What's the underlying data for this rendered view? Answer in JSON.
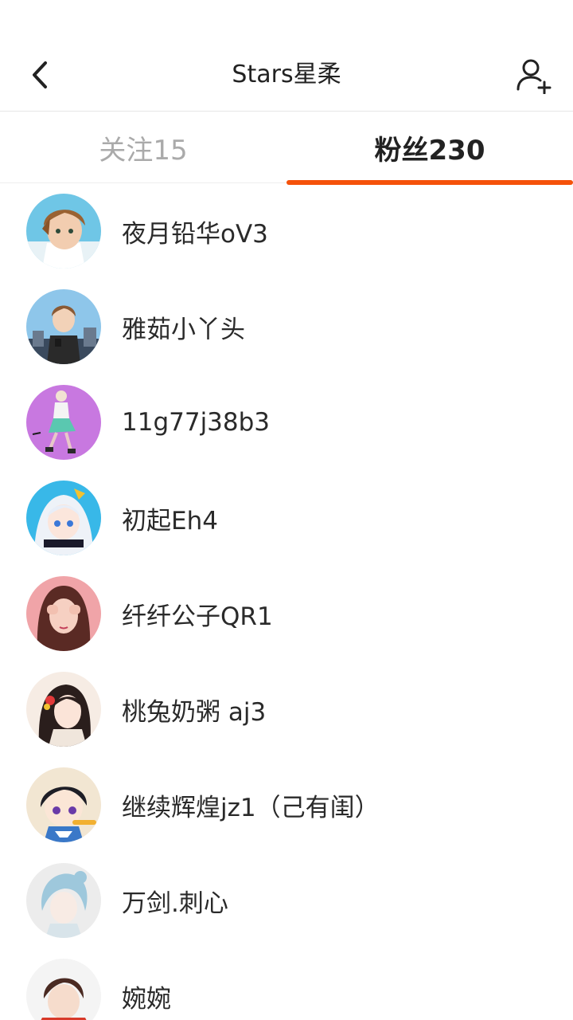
{
  "header": {
    "title": "Stars星柔",
    "back_icon": "chevron-left-icon",
    "add_user_icon": "user-plus-icon"
  },
  "tabs": [
    {
      "label": "关注15",
      "active": false
    },
    {
      "label": "粉丝230",
      "active": true
    }
  ],
  "colors": {
    "accent": "#f5520a",
    "inactive_tab": "#aaaaaa",
    "text": "#2a2a2a"
  },
  "fans": [
    {
      "name": "夜月铅华oV3",
      "avatar": "anime-boy-brown-hair-avatar"
    },
    {
      "name": "雅茹小丫头",
      "avatar": "anime-boy-standing-avatar"
    },
    {
      "name": "11g77j38b3",
      "avatar": "fashion-illustration-purple-avatar"
    },
    {
      "name": "初起Eh4",
      "avatar": "anime-girl-white-hair-avatar"
    },
    {
      "name": "纤纤公子QR1",
      "avatar": "girl-photo-pink-avatar"
    },
    {
      "name": "桃兔奶粥 aj3",
      "avatar": "ancient-style-girl-avatar"
    },
    {
      "name": "继续辉煌jz1（己有闺）",
      "avatar": "anime-boy-sailor-avatar"
    },
    {
      "name": "万剑.刺心",
      "avatar": "anime-boy-blue-hair-avatar"
    },
    {
      "name": "婉婉",
      "avatar": "anime-boy-red-avatar"
    }
  ]
}
